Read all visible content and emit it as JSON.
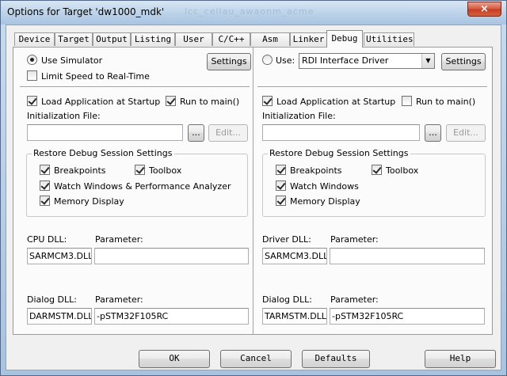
{
  "window": {
    "title": "Options for Target 'dw1000_mdk'",
    "ghost_title": "lcc_cellau_awaonm_acme",
    "close_glyph": "×"
  },
  "tabs": [
    {
      "label": "Device",
      "active": false
    },
    {
      "label": "Target",
      "active": false
    },
    {
      "label": "Output",
      "active": false
    },
    {
      "label": "Listing",
      "active": false
    },
    {
      "label": "User",
      "active": false
    },
    {
      "label": "C/C++",
      "active": false
    },
    {
      "label": "Asm",
      "active": false
    },
    {
      "label": "Linker",
      "active": false
    },
    {
      "label": "Debug",
      "active": true
    },
    {
      "label": "Utilities",
      "active": false
    }
  ],
  "left": {
    "use_simulator_label": "Use Simulator",
    "use_simulator_selected": true,
    "settings_label": "Settings",
    "limit_speed_label": "Limit Speed to Real-Time",
    "limit_speed_checked": false,
    "load_app_label": "Load Application at Startup",
    "load_app_checked": true,
    "run_to_main_label": "Run to main()",
    "run_to_main_checked": true,
    "init_file_label": "Initialization File:",
    "init_file_value": "",
    "browse_label": "...",
    "edit_label": "Edit...",
    "restore_group_title": "Restore Debug Session Settings",
    "breakpoints_label": "Breakpoints",
    "toolbox_label": "Toolbox",
    "watch_label": "Watch Windows & Performance Analyzer",
    "memory_label": "Memory Display",
    "cpu_dll_label": "CPU DLL:",
    "cpu_dll_value": "SARMCM3.DLL",
    "cpu_param_label": "Parameter:",
    "cpu_param_value": "",
    "dialog_dll_label": "Dialog DLL:",
    "dialog_dll_value": "DARMSTM.DLL",
    "dialog_param_label": "Parameter:",
    "dialog_param_value": "-pSTM32F105RC"
  },
  "right": {
    "use_label": "Use:",
    "use_selected": false,
    "driver_select_value": "RDI Interface Driver",
    "settings_label": "Settings",
    "load_app_label": "Load Application at Startup",
    "load_app_checked": true,
    "run_to_main_label": "Run to main()",
    "run_to_main_checked": false,
    "init_file_label": "Initialization File:",
    "init_file_value": "",
    "browse_label": "...",
    "edit_label": "Edit...",
    "restore_group_title": "Restore Debug Session Settings",
    "breakpoints_label": "Breakpoints",
    "toolbox_label": "Toolbox",
    "watch_label": "Watch Windows",
    "memory_label": "Memory Display",
    "driver_dll_label": "Driver DLL:",
    "driver_dll_value": "SARMCM3.DLL",
    "driver_param_label": "Parameter:",
    "driver_param_value": "",
    "dialog_dll_label": "Dialog DLL:",
    "dialog_dll_value": "TARMSTM.DLL",
    "dialog_param_label": "Parameter:",
    "dialog_param_value": "-pSTM32F105RC"
  },
  "footer": {
    "ok_label": "OK",
    "cancel_label": "Cancel",
    "defaults_label": "Defaults",
    "help_label": "Help"
  }
}
